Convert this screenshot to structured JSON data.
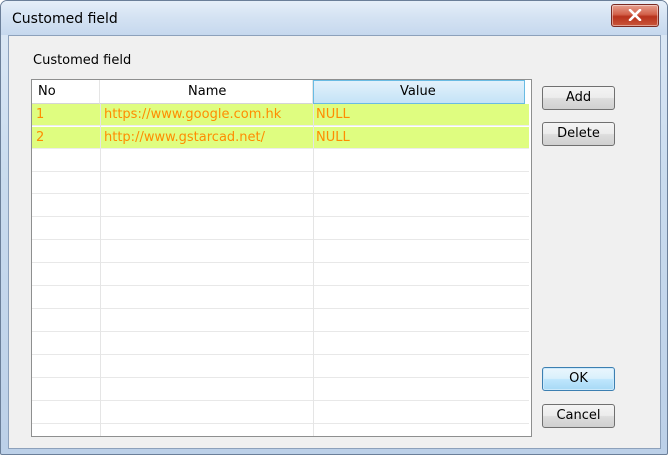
{
  "window": {
    "title": "Customed field"
  },
  "group": {
    "label": "Customed field"
  },
  "table": {
    "columns": [
      "No",
      "Name",
      "Value"
    ],
    "rows": [
      {
        "no": "1",
        "name": "https://www.google.com.hk",
        "value": "NULL"
      },
      {
        "no": "2",
        "name": "http://www.gstarcad.net/",
        "value": "NULL"
      }
    ],
    "row_highlight_color": "#dffd80",
    "text_color": "#ff8c00"
  },
  "buttons": {
    "add": "Add",
    "delete": "Delete",
    "ok": "OK",
    "cancel": "Cancel"
  },
  "icons": {
    "close": "close-x-icon"
  }
}
